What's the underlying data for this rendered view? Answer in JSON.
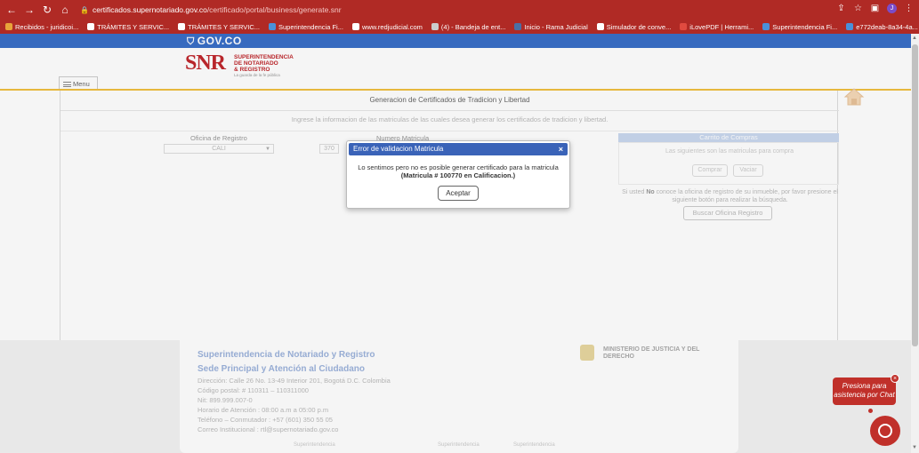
{
  "browser": {
    "url_domain": "certificados.supernotariado.gov.co",
    "url_path": "/certificado/portal/business/generate.snr",
    "bookmarks": [
      {
        "label": "Recibidos - juridicoi...",
        "color": "#e8a33a"
      },
      {
        "label": "TRÁMITES Y SERVIC...",
        "color": "#ffffff"
      },
      {
        "label": "TRÁMITES Y SERVIC...",
        "color": "#ffffff"
      },
      {
        "label": "Superintendencia Fi...",
        "color": "#4a90d9"
      },
      {
        "label": "www.redjudicial.com",
        "color": "#ffffff"
      },
      {
        "label": "(4) - Bandeja de ent...",
        "color": "#cccccc"
      },
      {
        "label": "Inicio - Rama Judicial",
        "color": "#4a6fa5"
      },
      {
        "label": "Simulador de conve...",
        "color": "#ffffff"
      },
      {
        "label": "iLovePDF | Herrami...",
        "color": "#e04a3f"
      },
      {
        "label": "Superintendencia Fi...",
        "color": "#4a90d9"
      },
      {
        "label": "e772deab-8a34-4a...",
        "color": "#4a90d9"
      }
    ],
    "avatar_letter": "J"
  },
  "header": {
    "gov_logo": "GOV.CO",
    "snr_big": "SNR",
    "snr_lines": [
      "SUPERINTENDENCIA",
      "DE NOTARIADO",
      "& REGISTRO"
    ],
    "snr_tagline": "La guarda de la fe pública",
    "menu_label": "Menu"
  },
  "panel": {
    "title": "Generacion de Certificados de Tradicion y Libertad",
    "subtitle": "Ingrese la informacion de las matriculas de las cuales desea generar los certificados de tradicion y libertad.",
    "oficina_label": "Oficina de Registro",
    "oficina_value": "CALI",
    "matricula_label": "Numero Matricula",
    "matricula_code": "370",
    "cart_title": "Carrito de Compras",
    "cart_text": "Las siguientes son las matriculas para compra",
    "cart_btn_comprar": "Comprar",
    "cart_btn_vaciar": "Vaciar",
    "help_pre": "Si usted ",
    "help_bold": "No",
    "help_post": " conoce la oficina de registro de su inmueble, por favor presione el siguiente botón para realizar la búsqueda.",
    "buscar_btn": "Buscar Oficina Registro"
  },
  "modal": {
    "title": "Error de validacion Matricula",
    "close": "×",
    "message": "Lo sentimos pero no es posible generar certificado para la matricula",
    "detail": "(Matricula # 100770 en Calificacion.)",
    "accept": "Aceptar"
  },
  "footer": {
    "org": "Superintendencia de Notariado y Registro",
    "sede": "Sede Principal y Atención al Ciudadano",
    "lines": [
      "Dirección: Calle 26 No. 13-49 Interior 201, Bogotá D.C. Colombia",
      "Código postal: # 110311 – 110311000",
      "Nit: 899.999.007-0",
      "Horario de Atención : 08:00 a.m a 05:00 p.m",
      "Teléfono – Conmutador : +57 (601) 350 55 05",
      "Correo Institucional : rtl@supernotariado.gov.co"
    ],
    "ministry": "MINISTERIO DE JUSTICIA Y DEL DERECHO",
    "bottom_labels": [
      "Superintendencia",
      "Superintendencia",
      "Superintendencia"
    ]
  },
  "chat": {
    "text": "Presiona para asistencia por Chat",
    "close": "×"
  }
}
